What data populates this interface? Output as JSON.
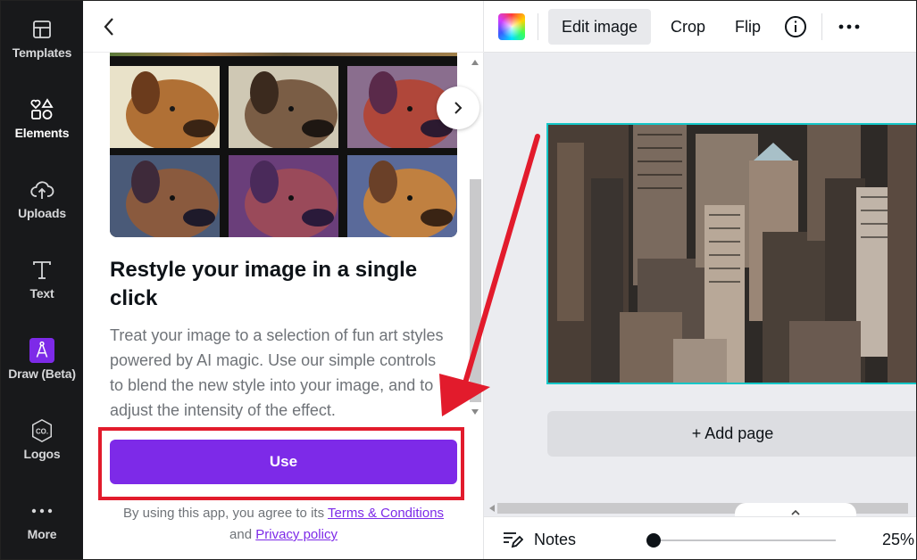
{
  "sidebar": {
    "items": [
      {
        "label": "Templates",
        "icon": "templates-icon"
      },
      {
        "label": "Elements",
        "icon": "elements-icon"
      },
      {
        "label": "Uploads",
        "icon": "upload-icon"
      },
      {
        "label": "Text",
        "icon": "text-icon"
      },
      {
        "label": "Draw (Beta)",
        "icon": "draw-icon"
      },
      {
        "label": "Logos",
        "icon": "logos-icon"
      },
      {
        "label": "More",
        "icon": "more-dots-icon"
      }
    ],
    "active": "Elements"
  },
  "panel": {
    "heading": "Restyle your image in a single click",
    "description": "Treat your image to a selection of fun art styles powered by AI magic. Use our simple controls to blend the new style into your image, and to adjust the intensity of the effect.",
    "use_label": "Use",
    "terms_prefix": "By using this app, you agree to its",
    "terms_link": "Terms & Conditions",
    "terms_and": "and",
    "privacy_link": "Privacy policy"
  },
  "toolbar": {
    "edit_image": "Edit image",
    "crop": "Crop",
    "flip": "Flip"
  },
  "canvas": {
    "add_page": "+ Add page"
  },
  "bottombar": {
    "notes": "Notes",
    "zoom": "25%",
    "zoom_level": 0.25
  },
  "colors": {
    "accent": "#7d2ae8",
    "highlight": "#e21b2c",
    "selection": "#14c7c8",
    "rail": "#18191b"
  }
}
